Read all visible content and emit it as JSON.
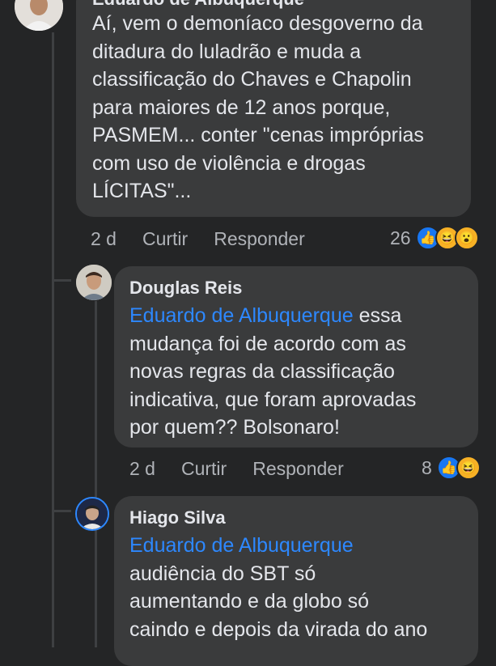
{
  "comments": [
    {
      "author": "Eduardo de Albuquerque",
      "text": "Aí, vem o demoníaco desgoverno da ditadura do luladrão e muda a classificação do Chaves e Chapolin para maiores de 12 anos porque, PASMEM... conter \"cenas impróprias com uso de violência e drogas LÍCITAS\"...",
      "lines": [
        "Aí, vem o demoníaco desgoverno da",
        "ditadura do luladrão e muda a",
        "classificação do Chaves e Chapolin",
        "para maiores de 12 anos porque,",
        "PASMEM... conter \"cenas impróprias",
        "com uso de violência e drogas",
        "LÍCITAS\"..."
      ],
      "time": "2 d",
      "like_label": "Curtir",
      "reply_label": "Responder",
      "reaction_count": "26",
      "reaction_icons": [
        "like-icon",
        "haha-icon",
        "wow-icon"
      ]
    },
    {
      "author": "Douglas Reis",
      "mention": "Eduardo de Albuquerque",
      "lines": [
        " essa",
        "mudança foi de acordo com as",
        "novas regras da classificação",
        "indicativa, que foram aprovadas",
        "por quem?? Bolsonaro!"
      ],
      "time": "2 d",
      "like_label": "Curtir",
      "reply_label": "Responder",
      "reaction_count": "8",
      "reaction_icons": [
        "like-icon",
        "haha-icon"
      ]
    },
    {
      "author": "Hiago Silva",
      "mention": "Eduardo de Albuquerque",
      "lines": [
        "audiência do SBT só",
        "aumentando e da globo só",
        "caindo e depois da virada do ano"
      ]
    }
  ],
  "colors": {
    "background": "#242526",
    "bubble": "#3a3b3c",
    "mention": "#2d88ff",
    "like": "#1877f2",
    "haha": "#f7b125"
  }
}
